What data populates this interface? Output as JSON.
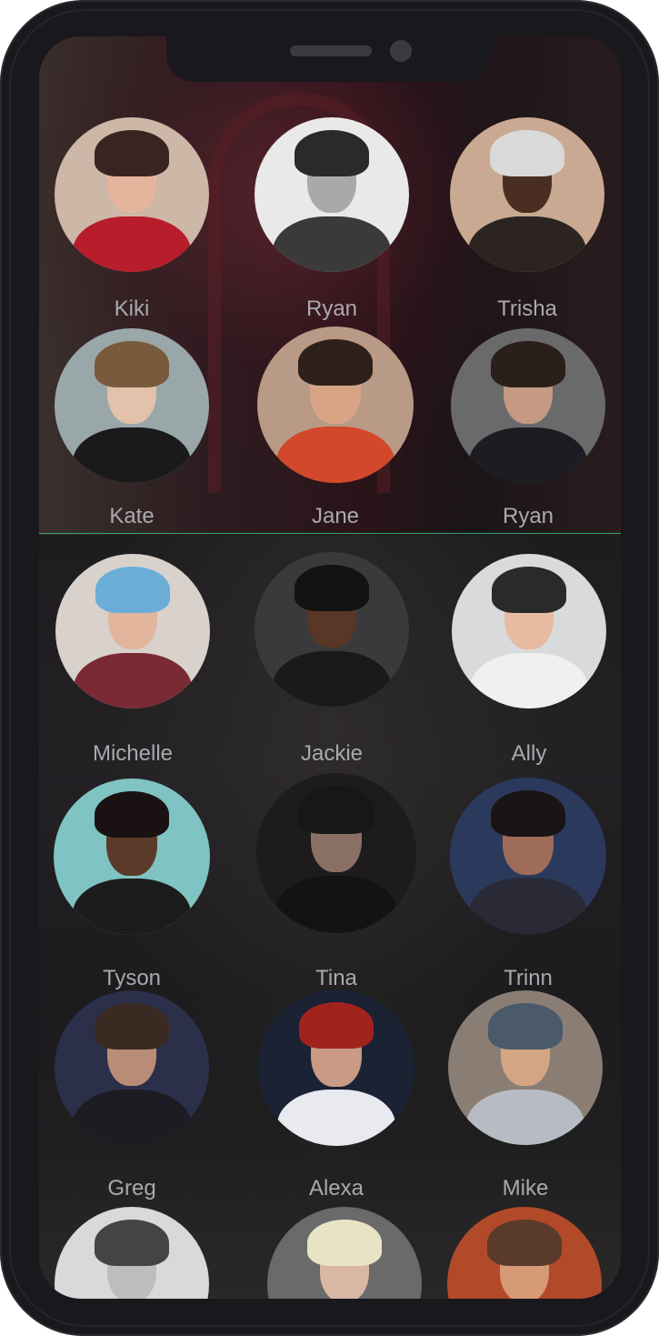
{
  "contacts": [
    {
      "name": "Kiki",
      "colors": {
        "bg": "#cdb7a6",
        "hair": "#3a2420",
        "skin": "#e4b59c",
        "body": "#b81d2c"
      }
    },
    {
      "name": "Ryan",
      "colors": {
        "bg": "#e9e9e9",
        "hair": "#2a2a2a",
        "skin": "#a9a9a9",
        "body": "#3a3a3a"
      }
    },
    {
      "name": "Trisha",
      "colors": {
        "bg": "#c9a991",
        "hair": "#d9d9d9",
        "skin": "#4a2e22",
        "body": "#2b2421"
      }
    },
    {
      "name": "Kate",
      "colors": {
        "bg": "#9aa7a8",
        "hair": "#7a5a3c",
        "skin": "#e3c1aa",
        "body": "#1a1a1a"
      }
    },
    {
      "name": "Jane",
      "colors": {
        "bg": "#b99a86",
        "hair": "#2e201a",
        "skin": "#d7a585",
        "body": "#d3472a"
      }
    },
    {
      "name": "Ryan",
      "colors": {
        "bg": "#6b6a6b",
        "hair": "#2a1f1a",
        "skin": "#c49a83",
        "body": "#1c1c22"
      }
    },
    {
      "name": "Michelle",
      "colors": {
        "bg": "#d8d1cc",
        "hair": "#6aaed8",
        "skin": "#e2b59c",
        "body": "#7a2a34"
      }
    },
    {
      "name": "Jackie",
      "colors": {
        "bg": "#3a3a3c",
        "hair": "#121212",
        "skin": "#5a3626",
        "body": "#1a1a1a"
      }
    },
    {
      "name": "Ally",
      "colors": {
        "bg": "#d9dadb",
        "hair": "#2a2a2a",
        "skin": "#e6bba1",
        "body": "#efefef"
      }
    },
    {
      "name": "Tyson",
      "colors": {
        "bg": "#7fc3c2",
        "hair": "#1a1212",
        "skin": "#5c3a2a",
        "body": "#1c1c1c"
      }
    },
    {
      "name": "Tina",
      "colors": {
        "bg": "#1d1b1c",
        "hair": "#191617",
        "skin": "#8a7064",
        "body": "#141213"
      }
    },
    {
      "name": "Trinn",
      "colors": {
        "bg": "#2b3a5c",
        "hair": "#1a1414",
        "skin": "#a06c5a",
        "body": "#2a2a36"
      }
    },
    {
      "name": "Greg",
      "colors": {
        "bg": "#2b2f4a",
        "hair": "#3a2a22",
        "skin": "#b88c76",
        "body": "#1c1c22"
      }
    },
    {
      "name": "Alexa",
      "colors": {
        "bg": "#1a2233",
        "hair": "#a2221e",
        "skin": "#c99a84",
        "body": "#e9e9f0"
      }
    },
    {
      "name": "Mike",
      "colors": {
        "bg": "#8a7e74",
        "hair": "#4a5a6a",
        "skin": "#d3a585",
        "body": "#b7bcc4"
      }
    },
    {
      "name": "",
      "colors": {
        "bg": "#d9d9d9",
        "hair": "#444444",
        "skin": "#bdbdbd",
        "body": "#eeeeee"
      }
    },
    {
      "name": "",
      "colors": {
        "bg": "#6a6a6a",
        "hair": "#e8e3c4",
        "skin": "#d8b7a4",
        "body": "#cfcfcf"
      }
    },
    {
      "name": "",
      "colors": {
        "bg": "#b24a2a",
        "hair": "#5a3a2a",
        "skin": "#d59a76",
        "body": "#d87a4a"
      }
    }
  ]
}
